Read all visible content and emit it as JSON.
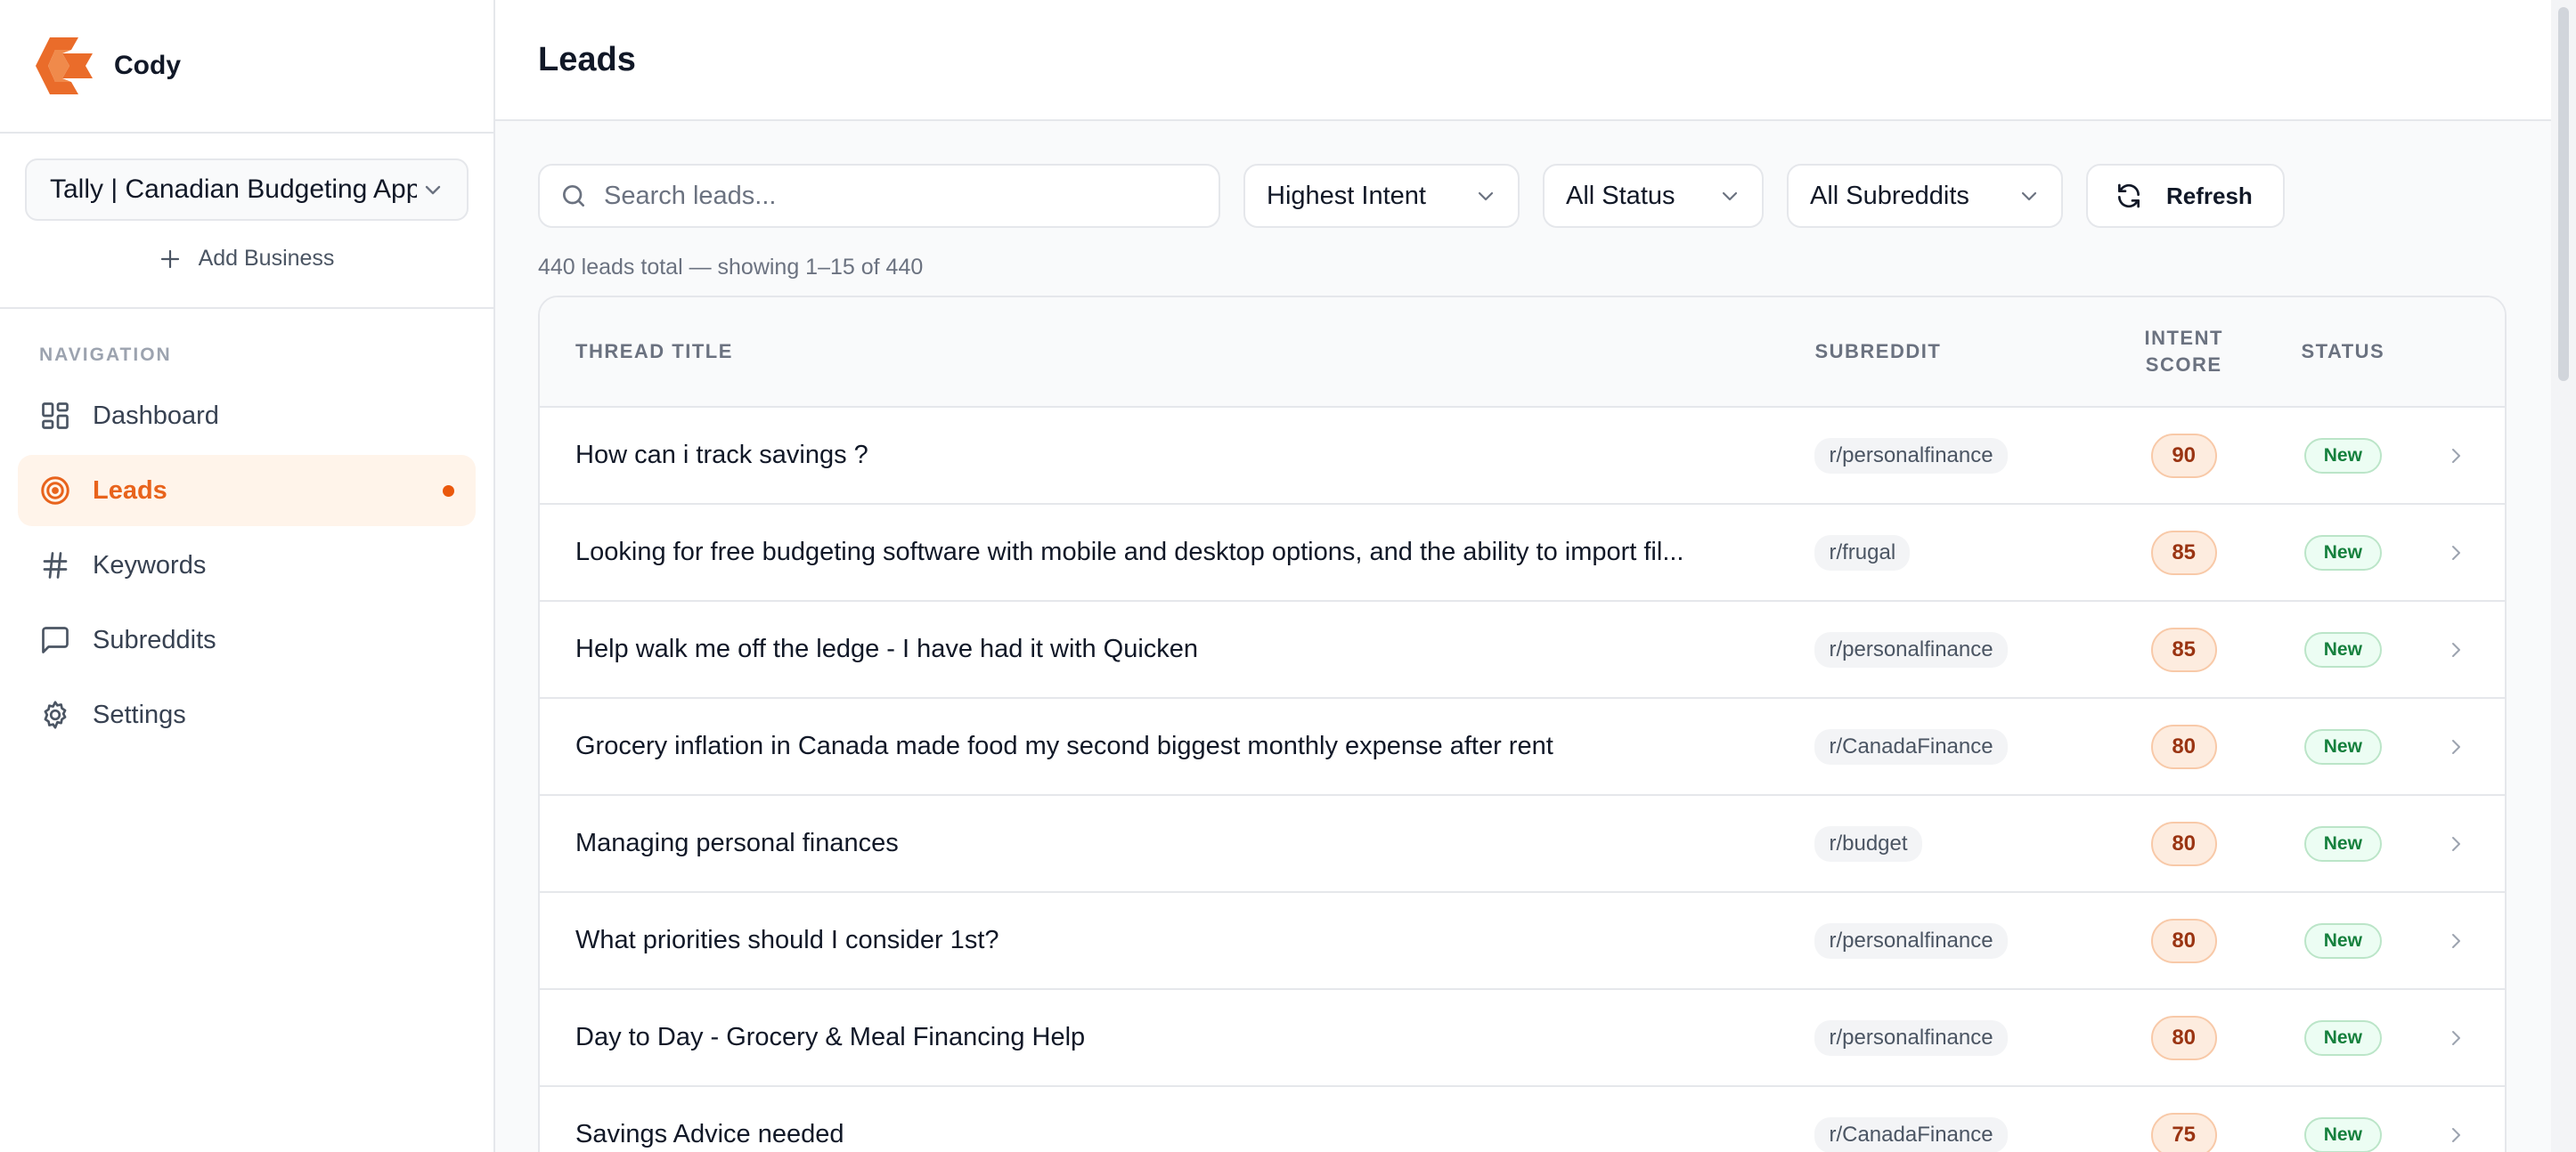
{
  "brand": {
    "name": "Cody",
    "color": "#EA6C2A"
  },
  "sidebar": {
    "business_select": "Tally | Canadian Budgeting App",
    "add_business": "Add Business",
    "nav_label": "NAVIGATION",
    "items": [
      {
        "label": "Dashboard",
        "icon": "dashboard-icon"
      },
      {
        "label": "Leads",
        "icon": "target-icon",
        "active": true
      },
      {
        "label": "Keywords",
        "icon": "hash-icon"
      },
      {
        "label": "Subreddits",
        "icon": "message-square-icon"
      },
      {
        "label": "Settings",
        "icon": "gear-icon"
      }
    ]
  },
  "header": {
    "title": "Leads"
  },
  "toolbar": {
    "search_placeholder": "Search leads...",
    "sort_value": "Highest Intent",
    "status_value": "All Status",
    "subreddit_value": "All Subreddits",
    "refresh_label": "Refresh"
  },
  "summary": "440 leads total — showing 1–15 of 440",
  "table": {
    "headers": {
      "title": "THREAD TITLE",
      "subreddit": "SUBREDDIT",
      "score_line1": "INTENT",
      "score_line2": "SCORE",
      "status": "STATUS"
    },
    "rows": [
      {
        "title": "How can i track savings ?",
        "subreddit": "r/personalfinance",
        "score": "90",
        "status": "New"
      },
      {
        "title": "Looking for free budgeting software with mobile and desktop options, and the ability to import fil...",
        "subreddit": "r/frugal",
        "score": "85",
        "status": "New"
      },
      {
        "title": "Help walk me off the ledge - I have had it with Quicken",
        "subreddit": "r/personalfinance",
        "score": "85",
        "status": "New"
      },
      {
        "title": "Grocery inflation in Canada made food my second biggest monthly expense after rent",
        "subreddit": "r/CanadaFinance",
        "score": "80",
        "status": "New"
      },
      {
        "title": "Managing personal finances",
        "subreddit": "r/budget",
        "score": "80",
        "status": "New"
      },
      {
        "title": "What priorities should I consider 1st?",
        "subreddit": "r/personalfinance",
        "score": "80",
        "status": "New"
      },
      {
        "title": "Day to Day - Grocery & Meal Financing Help",
        "subreddit": "r/personalfinance",
        "score": "80",
        "status": "New"
      },
      {
        "title": "Savings Advice needed",
        "subreddit": "r/CanadaFinance",
        "score": "75",
        "status": "New"
      }
    ]
  }
}
